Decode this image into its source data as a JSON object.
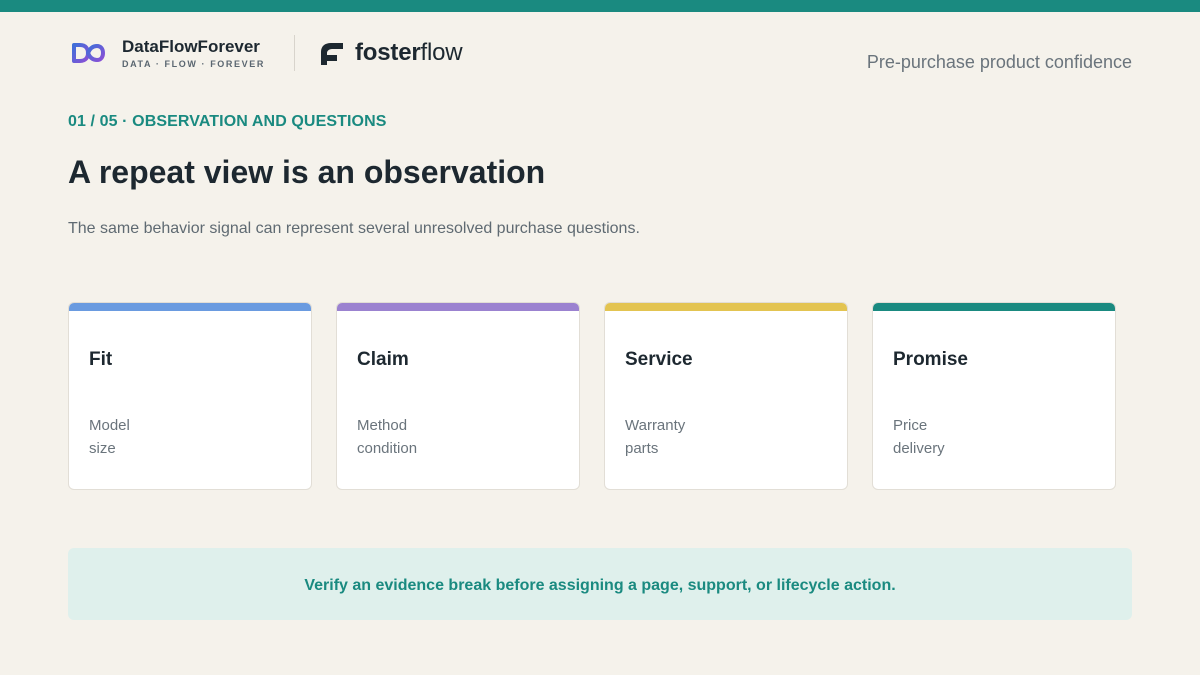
{
  "header": {
    "brand_name": "DataFlowForever",
    "brand_tagline": "DATA · FLOW · FOREVER",
    "partner_name_bold": "foster",
    "partner_name_light": "flow",
    "right_label": "Pre-purchase product confidence"
  },
  "slide": {
    "eyebrow": "01 / 05 · OBSERVATION AND QUESTIONS",
    "title": "A repeat view is an observation",
    "subtitle": "The same behavior signal can represent several unresolved purchase questions."
  },
  "cards": [
    {
      "title": "Fit",
      "lines": [
        "Model",
        "size"
      ],
      "accent": "#6a9be0"
    },
    {
      "title": "Claim",
      "lines": [
        "Method",
        "condition"
      ],
      "accent": "#9b82d0"
    },
    {
      "title": "Service",
      "lines": [
        "Warranty",
        "parts"
      ],
      "accent": "#e3c451"
    },
    {
      "title": "Promise",
      "lines": [
        "Price",
        "delivery"
      ],
      "accent": "#1a8a80"
    }
  ],
  "callout": {
    "text": "Verify an evidence break before assigning a page, support, or lifecycle action."
  },
  "colors": {
    "primary": "#1a8a80",
    "background": "#f5f2eb",
    "callout_bg": "#dff0ec"
  }
}
